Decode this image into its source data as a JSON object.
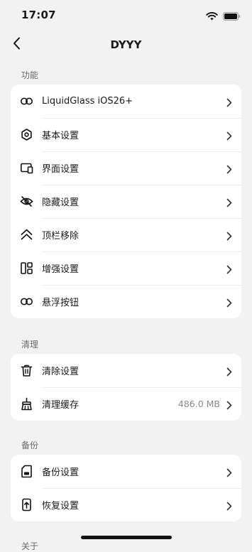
{
  "status": {
    "time": "17:07"
  },
  "nav": {
    "title": "DYYY"
  },
  "sections": [
    {
      "label": "功能",
      "items": [
        {
          "icon": "glasses-icon",
          "label": "LiquidGlass iOS26+"
        },
        {
          "icon": "gear-icon",
          "label": "基本设置"
        },
        {
          "icon": "devices-icon",
          "label": "界面设置"
        },
        {
          "icon": "eye-slash-icon",
          "label": "隐藏设置"
        },
        {
          "icon": "double-chevron-up-icon",
          "label": "顶栏移除"
        },
        {
          "icon": "grid-icon",
          "label": "增强设置"
        },
        {
          "icon": "glasses-icon",
          "label": "悬浮按钮"
        }
      ]
    },
    {
      "label": "清理",
      "items": [
        {
          "icon": "trash-icon",
          "label": "清除设置"
        },
        {
          "icon": "broom-icon",
          "label": "清理缓存",
          "value": "486.0 MB"
        }
      ]
    },
    {
      "label": "备份",
      "items": [
        {
          "icon": "sd-card-icon",
          "label": "备份设置"
        },
        {
          "icon": "phone-restore-icon",
          "label": "恢复设置"
        }
      ]
    },
    {
      "label": "关于"
    }
  ]
}
